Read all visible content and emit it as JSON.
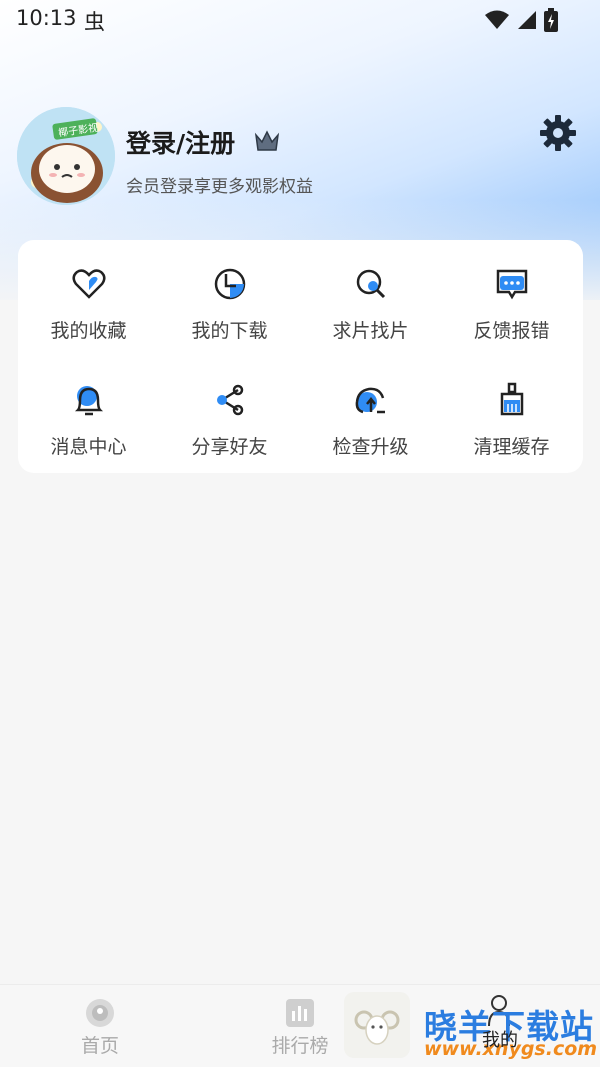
{
  "status_bar": {
    "time": "10:13",
    "bug_glyph": "虫"
  },
  "profile": {
    "title": "登录/注册",
    "subtitle": "会员登录享更多观影权益",
    "avatar_badge": "椰子影视"
  },
  "menu": {
    "items": [
      {
        "label": "我的收藏",
        "icon": "heart-icon"
      },
      {
        "label": "我的下载",
        "icon": "download-icon"
      },
      {
        "label": "求片找片",
        "icon": "search-icon"
      },
      {
        "label": "反馈报错",
        "icon": "feedback-icon"
      },
      {
        "label": "消息中心",
        "icon": "bell-icon"
      },
      {
        "label": "分享好友",
        "icon": "share-icon"
      },
      {
        "label": "检查升级",
        "icon": "upgrade-icon"
      },
      {
        "label": "清理缓存",
        "icon": "clean-icon"
      }
    ]
  },
  "bottom_nav": {
    "home": "首页",
    "ranking": "排行榜",
    "me": "我的"
  },
  "watermark": {
    "title": "晓羊下载站",
    "url": "www.xnygs.com"
  },
  "colors": {
    "accent": "#2f8cf4",
    "text": "#444444"
  }
}
